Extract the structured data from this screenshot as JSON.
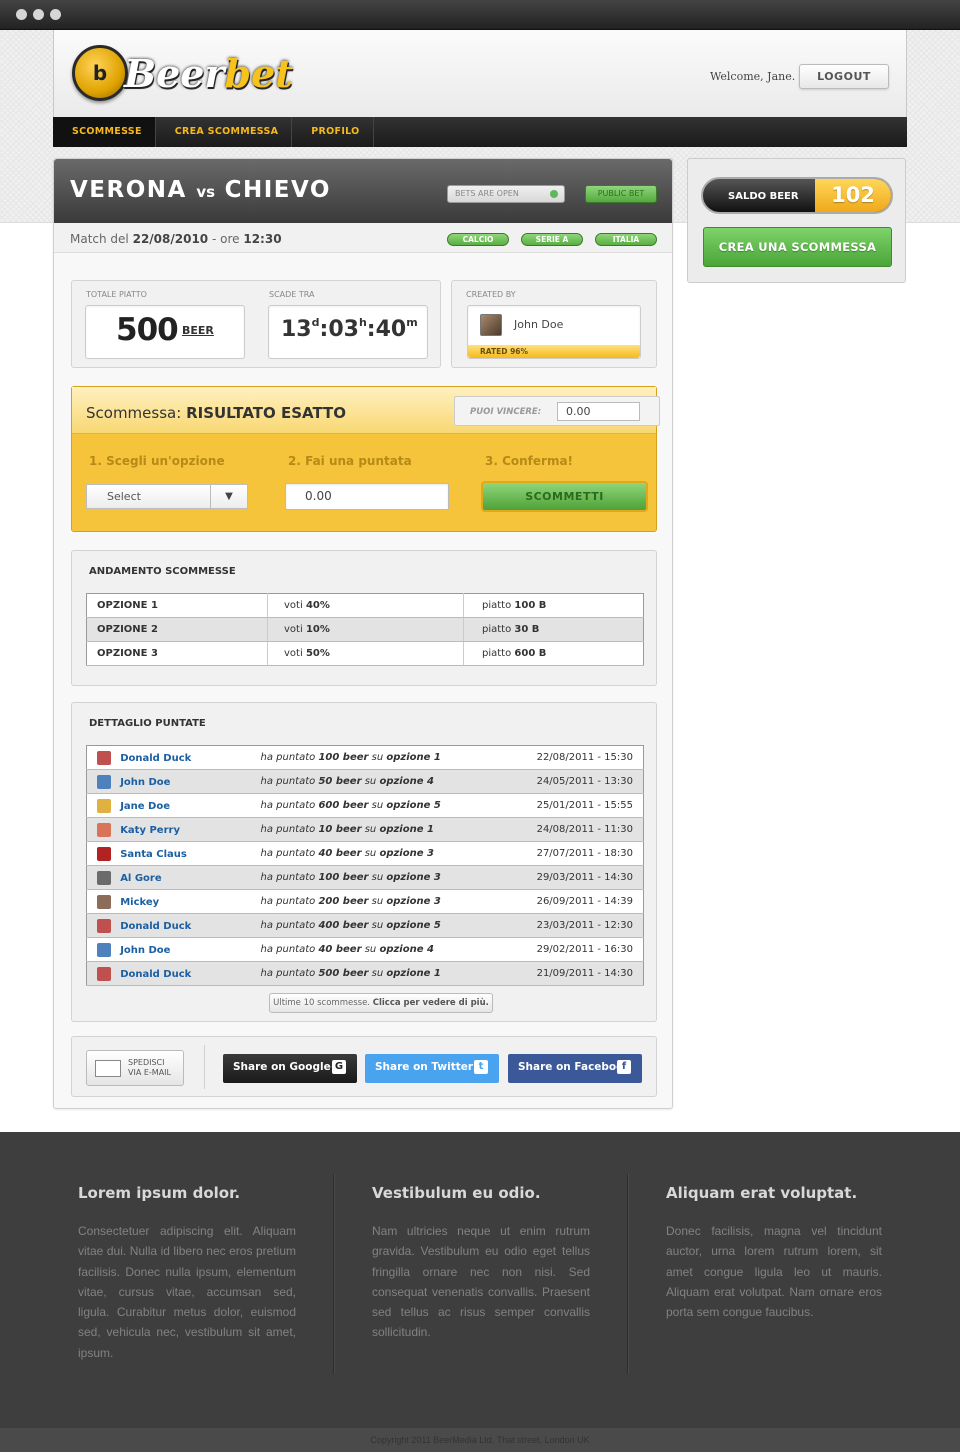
{
  "header": {
    "logo_text_1": "Beer",
    "logo_text_2": "bet",
    "logo_badge": "b",
    "welcome": "Welcome, Jane.",
    "logout_label": "LOGOUT"
  },
  "nav": {
    "items": [
      {
        "label": "SCOMMESSE",
        "active": true
      },
      {
        "label": "CREA SCOMMESSA",
        "active": false
      },
      {
        "label": "PROFILO",
        "active": false
      }
    ]
  },
  "match": {
    "team_a": "VERONA",
    "vs": "vs",
    "team_b": "CHIEVO",
    "bets_status": "BETS ARE OPEN",
    "public_label": "PUBLIC BET",
    "date_prefix": "Match del",
    "date": "22/08/2010",
    "time_prefix": "- ore",
    "time": "12:30",
    "tags": [
      "CALCIO",
      "SERIE A",
      "ITALIA"
    ]
  },
  "stats": {
    "pot_label": "TOTALE PIATTO",
    "pot_value": "500",
    "pot_unit": "BEER",
    "expire_label": "SCADE TRA",
    "days": "13",
    "days_unit": "d",
    "hours": "03",
    "hours_unit": "h",
    "minutes": "40",
    "minutes_unit": "m",
    "created_label": "CREATED BY",
    "creator": "John Doe",
    "rated": "RATED 96%"
  },
  "bet": {
    "title_prefix": "Scommessa:",
    "title": "RISULTATO ESATTO",
    "win_label": "PUOI VINCERE:",
    "win_value": "0.00",
    "step1": "1. Scegli un'opzione",
    "step2": "2. Fai una puntata",
    "step3": "3. Conferma!",
    "select_value": "Select",
    "stake_value": "0.00",
    "submit_label": "SCOMMETTI"
  },
  "trend": {
    "title": "ANDAMENTO SCOMMESSE",
    "vote_prefix": "voti",
    "pot_prefix": "piatto",
    "rows": [
      {
        "option": "OPZIONE 1",
        "votes": "40%",
        "pot": "100 B"
      },
      {
        "option": "OPZIONE 2",
        "votes": "10%",
        "pot": "30 B"
      },
      {
        "option": "OPZIONE 3",
        "votes": "50%",
        "pot": "600 B"
      }
    ]
  },
  "details": {
    "title": "DETTAGLIO PUNTATE",
    "bet_word": "ha puntato",
    "on_word": "su",
    "rows": [
      {
        "user": "Donald Duck",
        "amount": "100 beer",
        "option": "opzione 1",
        "date": "22/08/2011 - 15:30",
        "avatar_color": "#c0504d"
      },
      {
        "user": "John Doe",
        "amount": "50 beer",
        "option": "opzione 4",
        "date": "24/05/2011 - 13:30",
        "avatar_color": "#4f81bd"
      },
      {
        "user": "Jane Doe",
        "amount": "600 beer",
        "option": "opzione 5",
        "date": "25/01/2011 - 15:55",
        "avatar_color": "#e0b040"
      },
      {
        "user": "Katy Perry",
        "amount": "10 beer",
        "option": "opzione 1",
        "date": "24/08/2011 - 11:30",
        "avatar_color": "#d9745a"
      },
      {
        "user": "Santa Claus",
        "amount": "40 beer",
        "option": "opzione 3",
        "date": "27/07/2011 - 18:30",
        "avatar_color": "#b22222"
      },
      {
        "user": "Al Gore",
        "amount": "100 beer",
        "option": "opzione 3",
        "date": "29/03/2011 - 14:30",
        "avatar_color": "#6b6b6b"
      },
      {
        "user": "Mickey",
        "amount": "200 beer",
        "option": "opzione 3",
        "date": "26/09/2011 - 14:39",
        "avatar_color": "#8c6d5a"
      },
      {
        "user": "Donald Duck",
        "amount": "400 beer",
        "option": "opzione 5",
        "date": "23/03/2011 - 12:30",
        "avatar_color": "#c0504d"
      },
      {
        "user": "John Doe",
        "amount": "40 beer",
        "option": "opzione 4",
        "date": "29/02/2011 - 16:30",
        "avatar_color": "#4f81bd"
      },
      {
        "user": "Donald Duck",
        "amount": "500 beer",
        "option": "opzione 1",
        "date": "21/09/2011 - 14:30",
        "avatar_color": "#c0504d"
      }
    ],
    "more_prefix": "Ultime 10 scommesse.",
    "more_link": "Clicca per vedere di più."
  },
  "share": {
    "email_line1": "SPEDISCI",
    "email_line2": "VIA E-MAIL",
    "google": "Share on Google+",
    "twitter": "Share on Twitter",
    "facebook": "Share on Facebook",
    "google_icon": "G",
    "twitter_icon": "t",
    "facebook_icon": "f",
    "colors": {
      "google": "#1a1a1a",
      "twitter": "#4aa3ee",
      "facebook": "#3b5998"
    }
  },
  "sidebar": {
    "saldo_label": "SALDO BEER",
    "saldo_value": "102",
    "crea_label": "CREA UNA SCOMMESSA"
  },
  "footer": {
    "cols": [
      {
        "title": "Lorem ipsum dolor.",
        "text": "Consectetuer adipiscing elit. Aliquam vitae dui. Nulla id libero nec eros pretium facilisis. Donec nulla ipsum, elementum vitae, cursus vitae, accumsan sed, ligula. Curabitur metus dolor, euismod sed, vehicula nec, vestibulum sit amet, ipsum."
      },
      {
        "title": "Vestibulum eu odio.",
        "text": "Nam ultricies neque ut enim rutrum gravida. Vestibulum eu odio eget tellus fringilla ornare nec non nisi. Sed consequat venenatis convallis. Praesent sed tellus ac risus semper convallis sollicitudin."
      },
      {
        "title": "Aliquam erat voluptat.",
        "text": "Donec facilisis, magna vel tincidunt auctor, urna lorem rutrum lorem, sit amet congue ligula leo ut mauris. Aliquam erat volutpat. Nam ornare eros porta sem congue faucibus."
      }
    ],
    "copyright": "Copyright 2011 BeerMedia Ltd, That street, London UK"
  }
}
